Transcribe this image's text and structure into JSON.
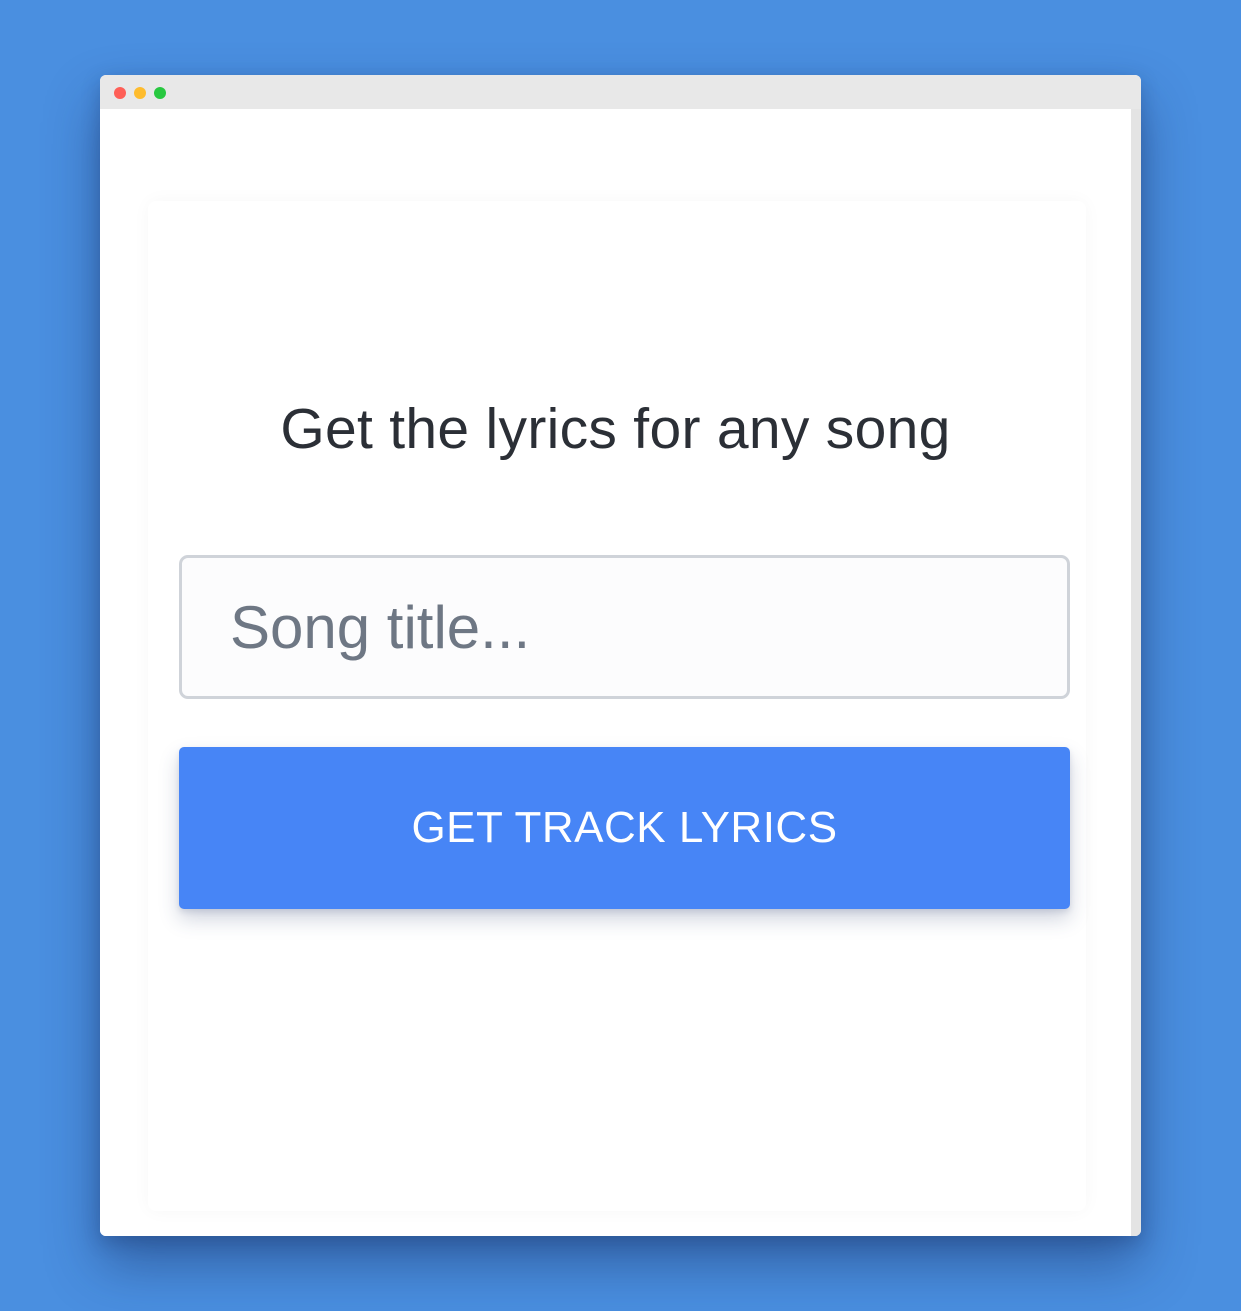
{
  "window": {
    "controls": [
      "close",
      "minimize",
      "maximize"
    ],
    "control_colors": {
      "close": "#fe5f57",
      "minimize": "#febc2e",
      "maximize": "#28c840"
    }
  },
  "main": {
    "heading": "Get the lyrics for any song",
    "search": {
      "value": "",
      "placeholder": "Song title..."
    },
    "submit_label": "GET TRACK LYRICS"
  },
  "colors": {
    "background": "#4a8fe0",
    "button": "#4785f6",
    "button_text": "#ffffff",
    "heading_text": "#2b2f36",
    "placeholder_text": "#6e7784"
  }
}
